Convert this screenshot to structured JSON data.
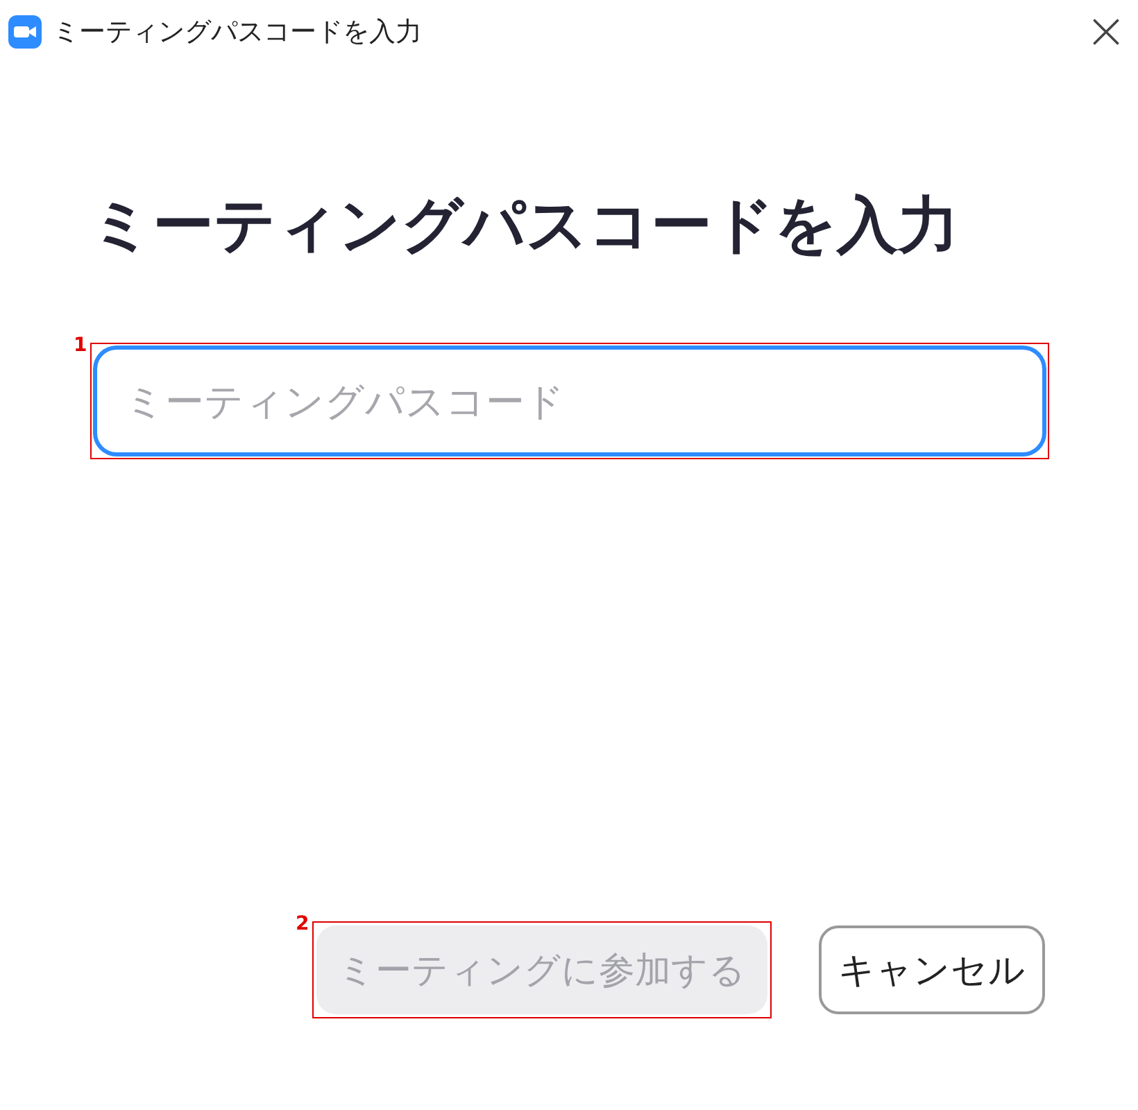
{
  "window": {
    "title": "ミーティングパスコードを入力"
  },
  "heading": "ミーティングパスコードを入力",
  "passcode_field": {
    "placeholder": "ミーティングパスコード",
    "focused": true,
    "callout": "1"
  },
  "buttons": [
    {
      "kind": "primary",
      "label": "ミーティングに参加する",
      "disabled": true,
      "callout": "2"
    },
    {
      "kind": "secondary",
      "label": "キャンセル",
      "disabled": false
    }
  ]
}
